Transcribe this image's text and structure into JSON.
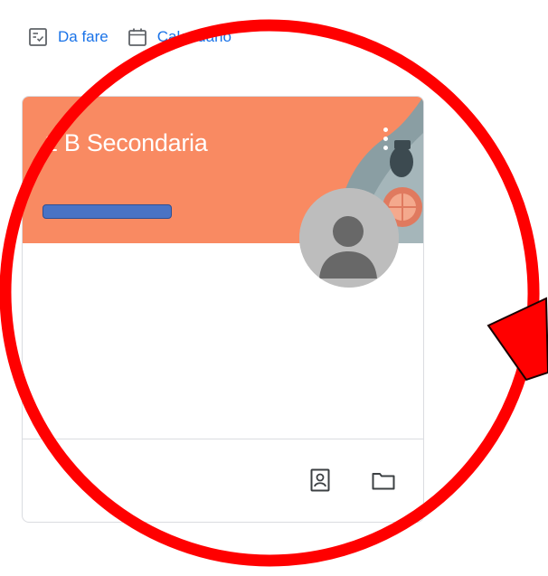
{
  "nav": {
    "todo_label": "Da fare",
    "todo_icon": "assignment-checklist-icon",
    "calendar_label": "Calendario",
    "calendar_icon": "calendar-icon",
    "link_color": "#1a73e8"
  },
  "card": {
    "title": "1 B Secondaria",
    "header_color": "#f98a62",
    "more_icon": "more-vertical-icon",
    "avatar_icon": "account-circle-icon",
    "footer_icons": [
      "work-badge-icon",
      "folder-icon"
    ]
  },
  "annotation": {
    "color": "#ff0000",
    "shapes": [
      "circle-highlight",
      "arrow-pointer"
    ]
  }
}
